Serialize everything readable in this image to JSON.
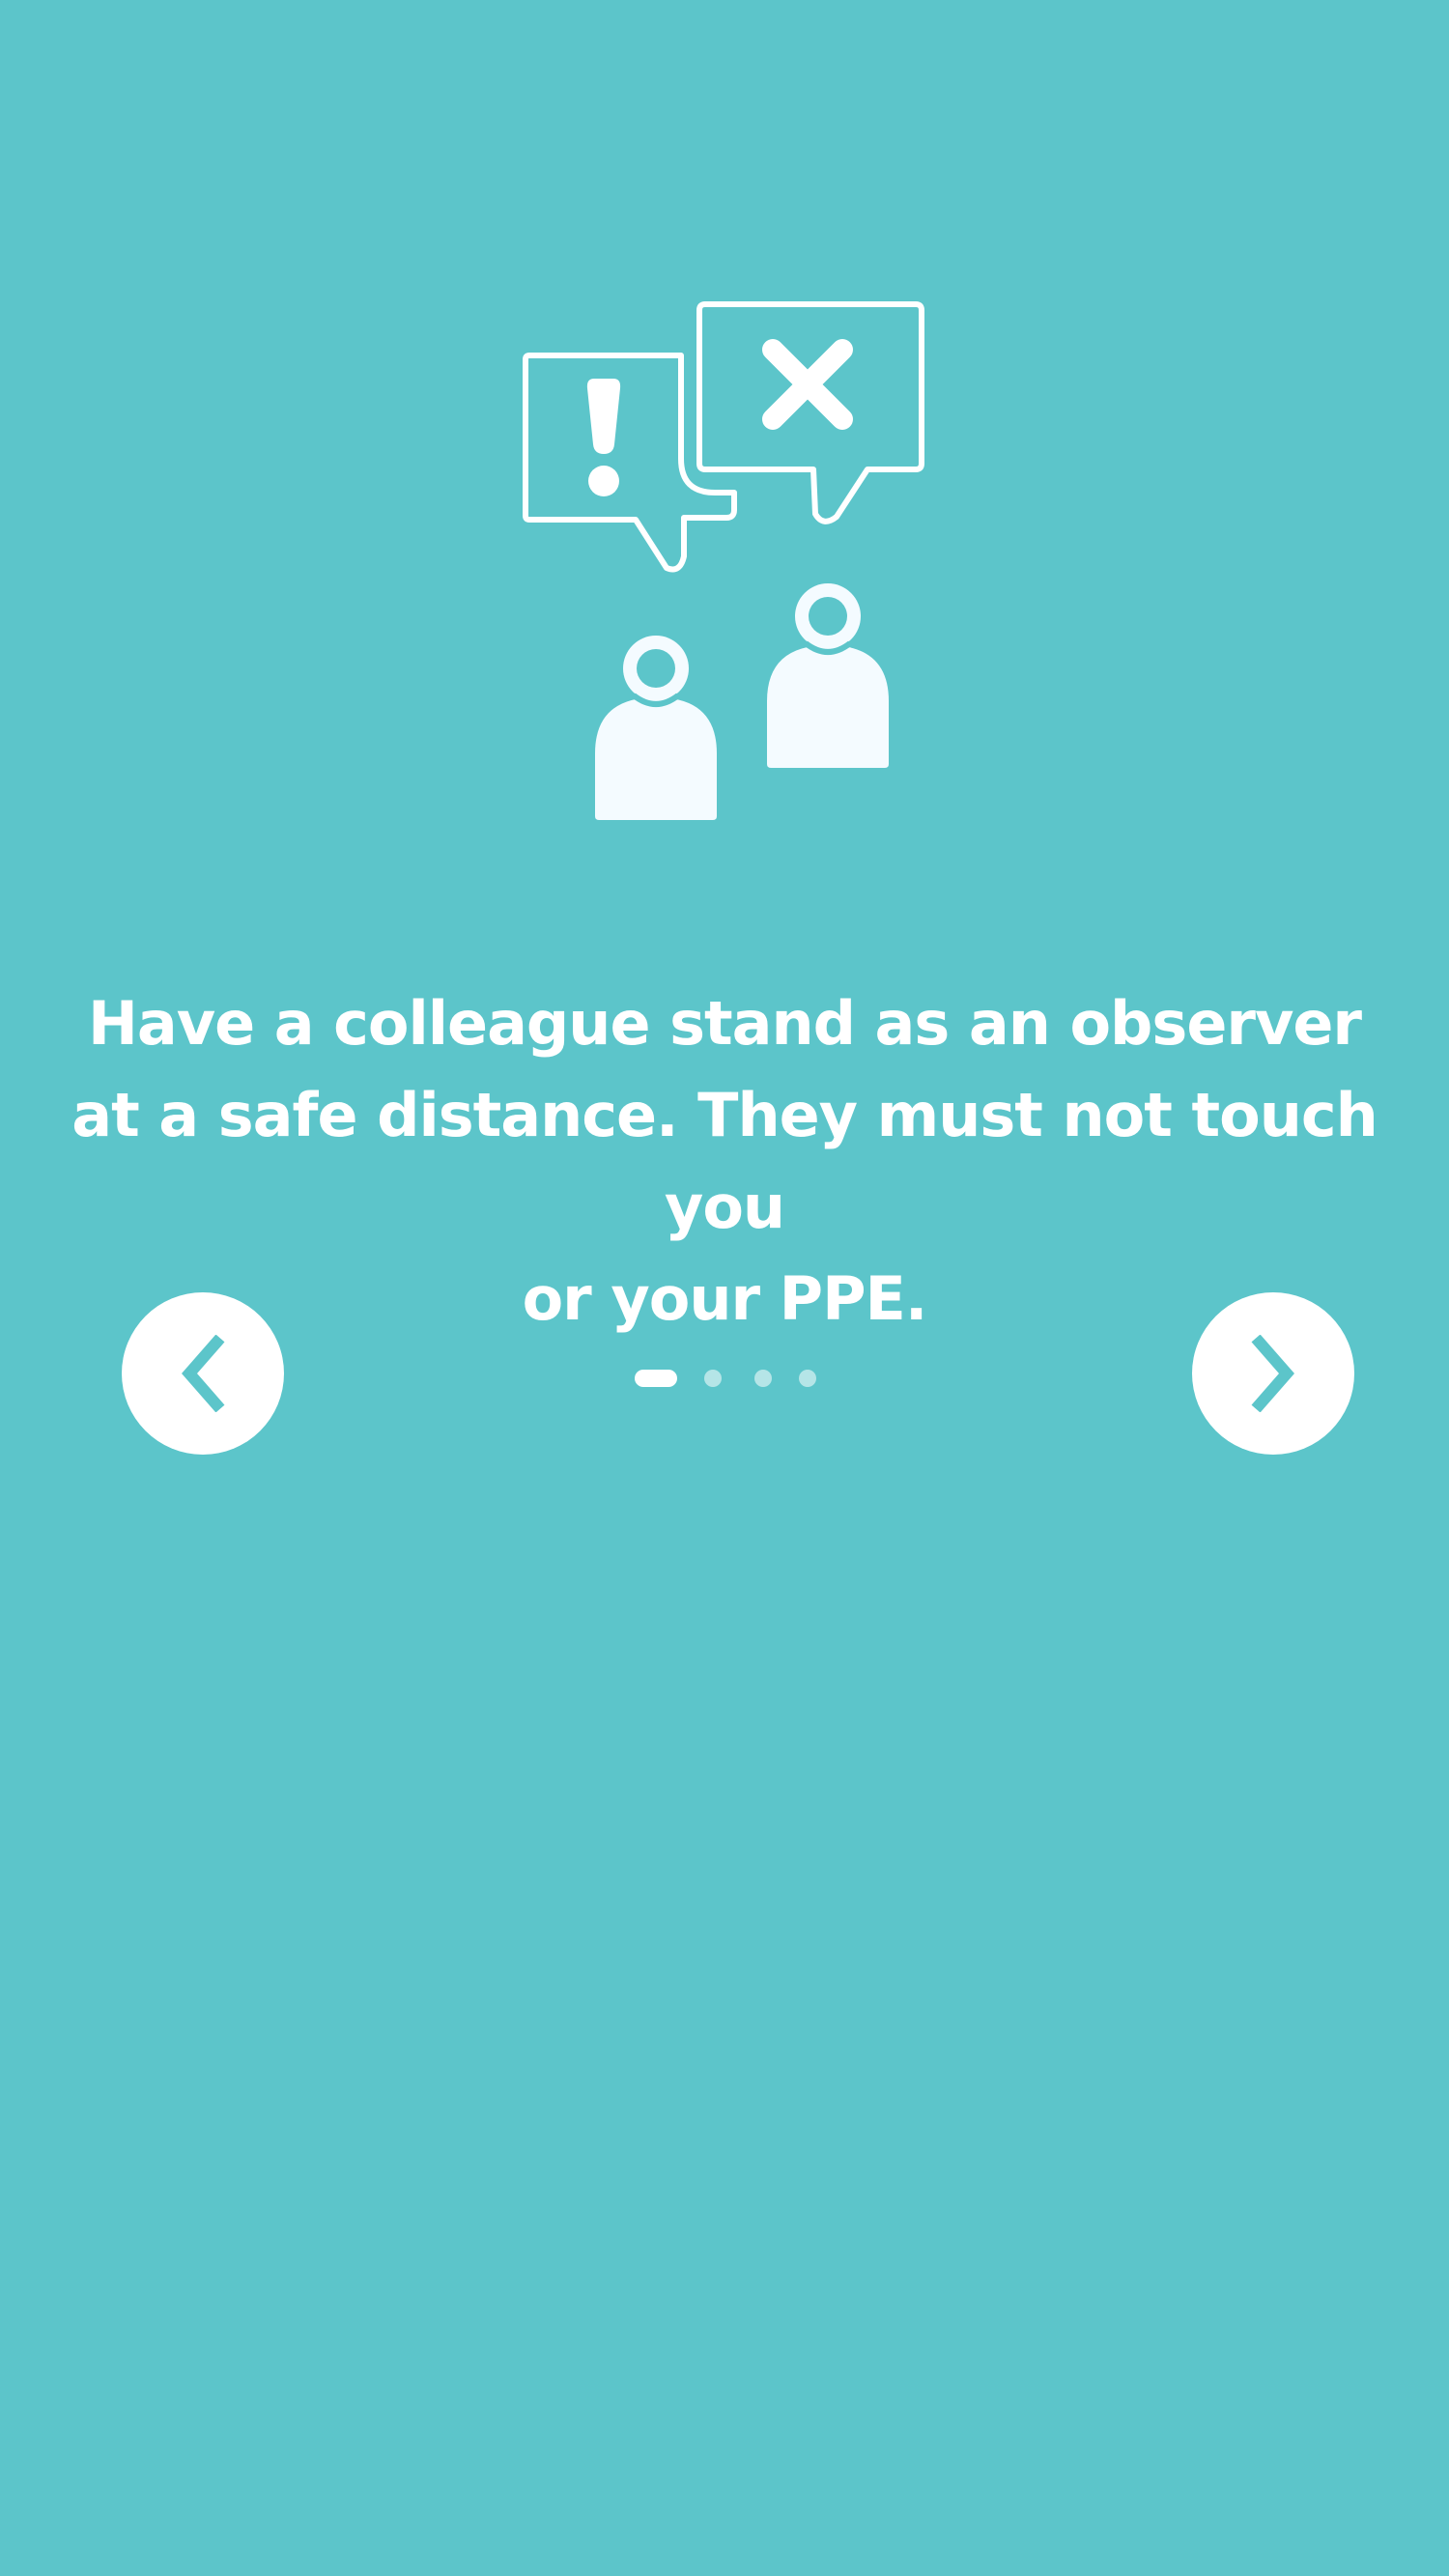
{
  "onboarding": {
    "instruction": "Have a colleague stand as an observer\nat a safe distance. They must not touch you\nor your PPE.",
    "total_steps": 4,
    "current_step": 1
  },
  "icons": {
    "illustration": "observer-speech-bubbles-illustration",
    "prev": "chevron-left-icon",
    "next": "chevron-right-icon"
  },
  "colors": {
    "background": "#5cc5ca",
    "foreground": "#ffffff",
    "accent": "#5cc5ca",
    "dot_inactive": "rgba(255,255,255,0.55)"
  }
}
